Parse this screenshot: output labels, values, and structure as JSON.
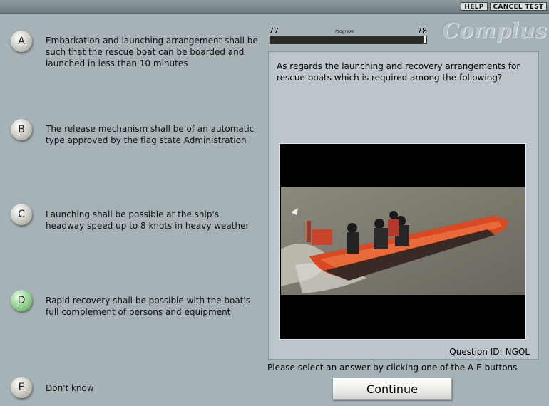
{
  "topbar": {
    "help_label": "HELP",
    "cancel_label": "CANCEL TEST"
  },
  "logo": {
    "text": "Complus"
  },
  "progress": {
    "current": "77",
    "total": "78",
    "label": "Progress",
    "fraction": 0.987
  },
  "question": {
    "text": "As regards the launching and recovery arrangements for rescue boats which is required among the following?",
    "id_label": "Question ID:",
    "id": "NGOL"
  },
  "answers": [
    {
      "letter": "A",
      "text": "Embarkation and launching arrangement shall be such that the rescue boat can be boarded and launched in less than 10 minutes",
      "selected": false
    },
    {
      "letter": "B",
      "text": "The release mechanism shall be of an automatic type approved by the flag state Administration",
      "selected": false
    },
    {
      "letter": "C",
      "text": "Launching shall be possible at the ship's headway speed up to 8 knots in heavy weather",
      "selected": false
    },
    {
      "letter": "D",
      "text": "Rapid recovery shall be possible with the boat's full complement of persons and equipment",
      "selected": true
    },
    {
      "letter": "E",
      "text": "Don't know",
      "selected": false
    }
  ],
  "instruction": "Please select an answer by clicking one of the A-E buttons",
  "continue_label": "Continue",
  "media": {
    "icon": "rescue-boat-photo",
    "boat_color": "#d94a24",
    "sea_color": "#7d7a70"
  }
}
